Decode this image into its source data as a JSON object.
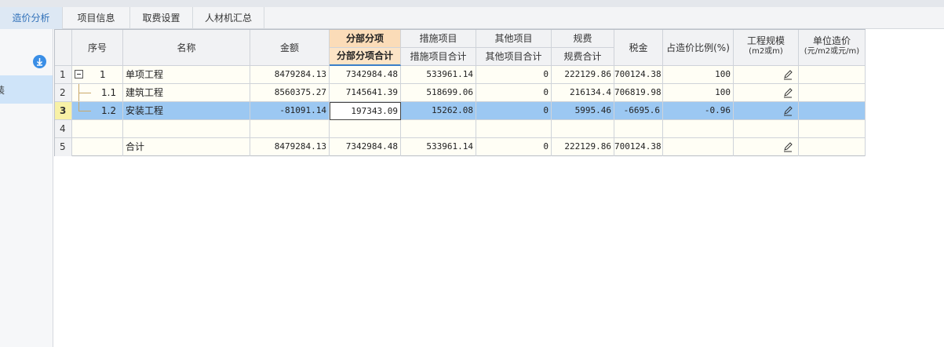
{
  "tabs": [
    {
      "label": "造价分析",
      "active": true
    },
    {
      "label": "项目信息",
      "active": false
    },
    {
      "label": "取费设置",
      "active": false
    },
    {
      "label": "人材机汇总",
      "active": false
    }
  ],
  "sidebar": {
    "selected_item": "装"
  },
  "headers": {
    "seq": "序号",
    "name": "名称",
    "amount": "金额",
    "fbfx": "分部分项",
    "fbfx_total": "分部分项合计",
    "csxm": "措施项目",
    "csxm_total": "措施项目合计",
    "qtxm": "其他项目",
    "qtxm_total": "其他项目合计",
    "gf": "规费",
    "gf_total": "规费合计",
    "sj": "税金",
    "ratio": "占造价比例(%)",
    "scale_line1": "工程规模",
    "scale_line2": "(m2或m)",
    "unit_line1": "单位造价",
    "unit_line2": "(元/m2或元/m)"
  },
  "rows": [
    {
      "rownum": "1",
      "seq": "1",
      "name": "单项工程",
      "amount": "8479284.13",
      "fbfx": "7342984.48",
      "csxm": "533961.14",
      "qtxm": "0",
      "gf": "222129.86",
      "sj": "700124.38",
      "ratio": "100",
      "scale": "",
      "unit": ""
    },
    {
      "rownum": "2",
      "seq": "1.1",
      "name": "建筑工程",
      "amount": "8560375.27",
      "fbfx": "7145641.39",
      "csxm": "518699.06",
      "qtxm": "0",
      "gf": "216134.4",
      "sj": "706819.98",
      "ratio": "100",
      "scale": "",
      "unit": ""
    },
    {
      "rownum": "3",
      "seq": "1.2",
      "name": "安装工程",
      "amount": "-81091.14",
      "fbfx": "197343.09",
      "csxm": "15262.08",
      "qtxm": "0",
      "gf": "5995.46",
      "sj": "-6695.6",
      "ratio": "-0.96",
      "scale": "",
      "unit": ""
    },
    {
      "rownum": "4",
      "seq": "",
      "name": "",
      "amount": "",
      "fbfx": "",
      "csxm": "",
      "qtxm": "",
      "gf": "",
      "sj": "",
      "ratio": "",
      "scale": "",
      "unit": ""
    },
    {
      "rownum": "5",
      "seq": "",
      "name": "合计",
      "amount": "8479284.13",
      "fbfx": "7342984.48",
      "csxm": "533961.14",
      "qtxm": "0",
      "gf": "222129.86",
      "sj": "700124.38",
      "ratio": "",
      "scale": "",
      "unit": ""
    }
  ],
  "colors": {
    "selected_row": "#9cc8f2",
    "header_orange": "#fbdcb8",
    "accent": "#2e6fb8"
  }
}
